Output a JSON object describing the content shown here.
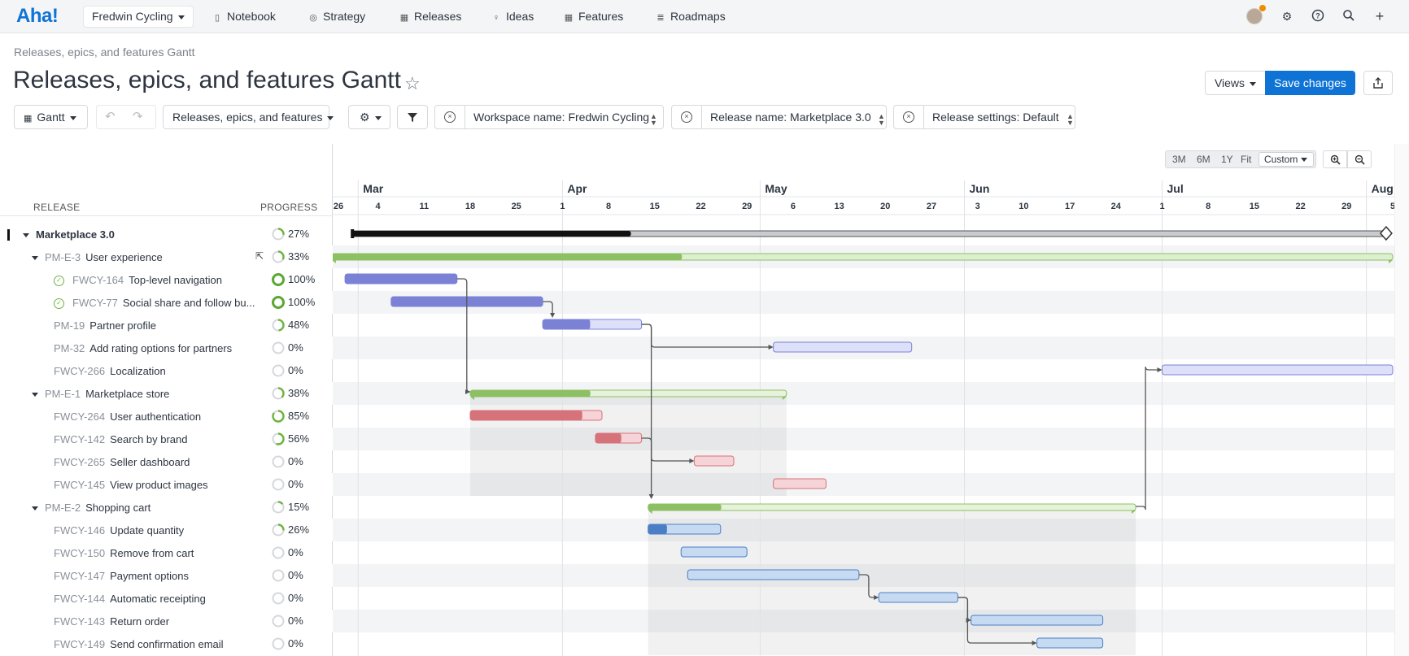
{
  "app": {
    "logo": "Aha!",
    "workspace": "Fredwin Cycling",
    "nav": [
      {
        "label": "Notebook",
        "icon": "notebook-icon",
        "glyph": "▯"
      },
      {
        "label": "Strategy",
        "icon": "target-icon",
        "glyph": "◎"
      },
      {
        "label": "Releases",
        "icon": "calendar-icon",
        "glyph": "▦"
      },
      {
        "label": "Ideas",
        "icon": "lightbulb-icon",
        "glyph": "♀"
      },
      {
        "label": "Features",
        "icon": "grid-icon",
        "glyph": "▦"
      },
      {
        "label": "Roadmaps",
        "icon": "roadmap-icon",
        "glyph": "≣"
      }
    ]
  },
  "header": {
    "breadcrumb": "Releases, epics, and features Gantt",
    "title": "Releases, epics, and features Gantt",
    "views_label": "Views",
    "save_label": "Save changes"
  },
  "toolbar": {
    "view_label": "Gantt",
    "records_label": "Releases, epics, and features",
    "filter_workspace": "Workspace name: Fredwin Cycling",
    "filter_release": "Release name: Marketplace 3.0",
    "filter_settings": "Release settings: Default"
  },
  "columns": {
    "release": "RELEASE",
    "progress": "PROGRESS"
  },
  "zoom": {
    "options": [
      "3M",
      "6M",
      "1Y",
      "Fit"
    ],
    "selected": "Custom"
  },
  "timeline": {
    "months": [
      "Mar",
      "Apr",
      "May",
      "Jun",
      "Jul",
      "Aug"
    ],
    "weeks": [
      "26",
      "4",
      "11",
      "18",
      "25",
      "1",
      "8",
      "15",
      "22",
      "29",
      "6",
      "13",
      "20",
      "27",
      "3",
      "10",
      "17",
      "24",
      "1",
      "8",
      "15",
      "22",
      "29",
      "5"
    ]
  },
  "rows": [
    {
      "key": "",
      "name": "Marketplace 3.0",
      "progress": "27%",
      "pct": 27,
      "level": 0,
      "type": "release"
    },
    {
      "key": "PM-E-3",
      "name": "User experience",
      "progress": "33%",
      "pct": 33,
      "level": 1,
      "type": "epic"
    },
    {
      "key": "FWCY-164",
      "name": "Top-level navigation",
      "progress": "100%",
      "pct": 100,
      "level": 2,
      "type": "done"
    },
    {
      "key": "FWCY-77",
      "name": "Social share and follow bu...",
      "progress": "100%",
      "pct": 100,
      "level": 2,
      "type": "done"
    },
    {
      "key": "PM-19",
      "name": "Partner profile",
      "progress": "48%",
      "pct": 48,
      "level": 2,
      "type": "feature"
    },
    {
      "key": "PM-32",
      "name": "Add rating options for partners",
      "progress": "0%",
      "pct": 0,
      "level": 2,
      "type": "feature"
    },
    {
      "key": "FWCY-266",
      "name": "Localization",
      "progress": "0%",
      "pct": 0,
      "level": 2,
      "type": "feature"
    },
    {
      "key": "PM-E-1",
      "name": "Marketplace store",
      "progress": "38%",
      "pct": 38,
      "level": 1,
      "type": "epic"
    },
    {
      "key": "FWCY-264",
      "name": "User authentication",
      "progress": "85%",
      "pct": 85,
      "level": 2,
      "type": "feature"
    },
    {
      "key": "FWCY-142",
      "name": "Search by brand",
      "progress": "56%",
      "pct": 56,
      "level": 2,
      "type": "feature"
    },
    {
      "key": "FWCY-265",
      "name": "Seller dashboard",
      "progress": "0%",
      "pct": 0,
      "level": 2,
      "type": "feature"
    },
    {
      "key": "FWCY-145",
      "name": "View product images",
      "progress": "0%",
      "pct": 0,
      "level": 2,
      "type": "feature"
    },
    {
      "key": "PM-E-2",
      "name": "Shopping cart",
      "progress": "15%",
      "pct": 15,
      "level": 1,
      "type": "epic"
    },
    {
      "key": "FWCY-146",
      "name": "Update quantity",
      "progress": "26%",
      "pct": 26,
      "level": 2,
      "type": "feature"
    },
    {
      "key": "FWCY-150",
      "name": "Remove from cart",
      "progress": "0%",
      "pct": 0,
      "level": 2,
      "type": "feature"
    },
    {
      "key": "FWCY-147",
      "name": "Payment options",
      "progress": "0%",
      "pct": 0,
      "level": 2,
      "type": "feature"
    },
    {
      "key": "FWCY-144",
      "name": "Automatic receipting",
      "progress": "0%",
      "pct": 0,
      "level": 2,
      "type": "feature"
    },
    {
      "key": "FWCY-143",
      "name": "Return order",
      "progress": "0%",
      "pct": 0,
      "level": 2,
      "type": "feature"
    },
    {
      "key": "FWCY-149",
      "name": "Send confirmation email",
      "progress": "0%",
      "pct": 0,
      "level": 2,
      "type": "feature"
    }
  ],
  "bars": [
    {
      "row": 1,
      "start": "Feb 25",
      "end": "Aug 5",
      "color": "#8cc063",
      "light": "#dcefcf",
      "pct": 33
    },
    {
      "row": 2,
      "start": "Feb 27",
      "end": "Mar 16",
      "color": "#7b82d6",
      "light": "#7b82d6",
      "pct": 100
    },
    {
      "row": 3,
      "start": "Mar 6",
      "end": "Mar 29",
      "color": "#7b82d6",
      "light": "#7b82d6",
      "pct": 100
    },
    {
      "row": 4,
      "start": "Mar 29",
      "end": "Apr 13",
      "color": "#7b82d6",
      "light": "#dde0f8",
      "pct": 48
    },
    {
      "row": 5,
      "start": "May 3",
      "end": "May 24",
      "color": "#7b82d6",
      "light": "#dde0f8",
      "pct": 0
    },
    {
      "row": 6,
      "start": "Jul 1",
      "end": "Aug 5",
      "color": "#7b82d6",
      "light": "#dde0f8",
      "pct": 0
    },
    {
      "row": 7,
      "start": "Mar 18",
      "end": "May 5",
      "color": "#8cc063",
      "light": "#e6f3da",
      "pct": 38
    },
    {
      "row": 8,
      "start": "Mar 18",
      "end": "Apr 7",
      "color": "#d6727a",
      "light": "#f5d3d6",
      "pct": 85
    },
    {
      "row": 9,
      "start": "Apr 6",
      "end": "Apr 13",
      "color": "#d6727a",
      "light": "#f5d3d6",
      "pct": 56
    },
    {
      "row": 10,
      "start": "Apr 21",
      "end": "Apr 27",
      "color": "#d6727a",
      "light": "#f5d3d6",
      "pct": 0
    },
    {
      "row": 11,
      "start": "May 3",
      "end": "May 11",
      "color": "#d6727a",
      "light": "#f5d3d6",
      "pct": 0
    },
    {
      "row": 12,
      "start": "Apr 14",
      "end": "Jun 27",
      "color": "#8cc063",
      "light": "#e6f3da",
      "pct": 15
    },
    {
      "row": 13,
      "start": "Apr 14",
      "end": "Apr 25",
      "color": "#4a7fc6",
      "light": "#c6daf2",
      "pct": 26
    },
    {
      "row": 14,
      "start": "Apr 19",
      "end": "Apr 29",
      "color": "#4a7fc6",
      "light": "#c6daf2",
      "pct": 0
    },
    {
      "row": 15,
      "start": "Apr 20",
      "end": "May 16",
      "color": "#4a7fc6",
      "light": "#c6daf2",
      "pct": 0
    },
    {
      "row": 16,
      "start": "May 19",
      "end": "May 31",
      "color": "#4a7fc6",
      "light": "#c6daf2",
      "pct": 0
    },
    {
      "row": 17,
      "start": "Jun 2",
      "end": "Jun 22",
      "color": "#4a7fc6",
      "light": "#c6daf2",
      "pct": 0
    },
    {
      "row": 18,
      "start": "Jun 12",
      "end": "Jun 22",
      "color": "#4a7fc6",
      "light": "#c6daf2",
      "pct": 0
    }
  ],
  "release_bar": {
    "start": "Feb 28",
    "end": "Aug 4",
    "pct": 27
  },
  "dependencies": [
    {
      "from": 2,
      "to": 7
    },
    {
      "from": 3,
      "to": 4
    },
    {
      "from": 4,
      "to": 5
    },
    {
      "from": 4,
      "to": 10
    },
    {
      "from": 9,
      "to": 12
    },
    {
      "from": 12,
      "to": 6
    },
    {
      "from": 15,
      "to": 16
    },
    {
      "from": 16,
      "to": 17
    },
    {
      "from": 16,
      "to": 18
    }
  ],
  "colors": {
    "accent": "#0f73d6",
    "epic": "#8cc063",
    "release": "#111111"
  }
}
